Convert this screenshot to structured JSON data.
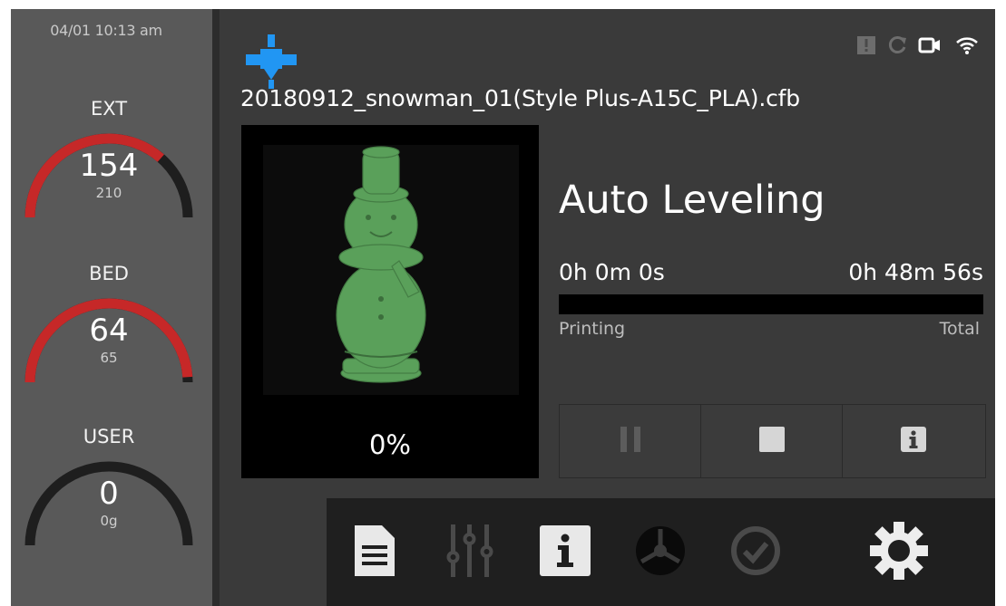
{
  "clock": "04/01 10:13 am",
  "gauges": {
    "ext": {
      "label": "EXT",
      "value": "154",
      "target": "210",
      "level": 0.73
    },
    "bed": {
      "label": "BED",
      "value": "64",
      "target": "65",
      "level": 0.98
    },
    "user": {
      "label": "USER",
      "value": "0",
      "unit_text": "0g",
      "level": 0
    }
  },
  "status_icons": [
    "alert-icon",
    "sync-icon",
    "camera-icon",
    "wifi-icon"
  ],
  "job": {
    "file_name": "20180912_snowman_01(Style Plus-A15C_PLA).cfb",
    "status": "Auto Leveling",
    "progress_text": "0%",
    "progress": 0,
    "time_elapsed": "0h 0m 0s",
    "time_total": "0h 48m 56s",
    "caption_printing": "Printing",
    "caption_total": "Total"
  },
  "controls": [
    "pause-icon",
    "stop-icon",
    "info-icon"
  ],
  "nav": [
    "print-head-icon",
    "file-icon",
    "tune-icon",
    "info-icon",
    "filament-icon",
    "check-icon",
    "settings-icon"
  ],
  "colors": {
    "gauge_active": "#c62828",
    "gauge_track": "#1e1e1e",
    "nav_active": "#2196f3",
    "model": "#5aa05a"
  }
}
